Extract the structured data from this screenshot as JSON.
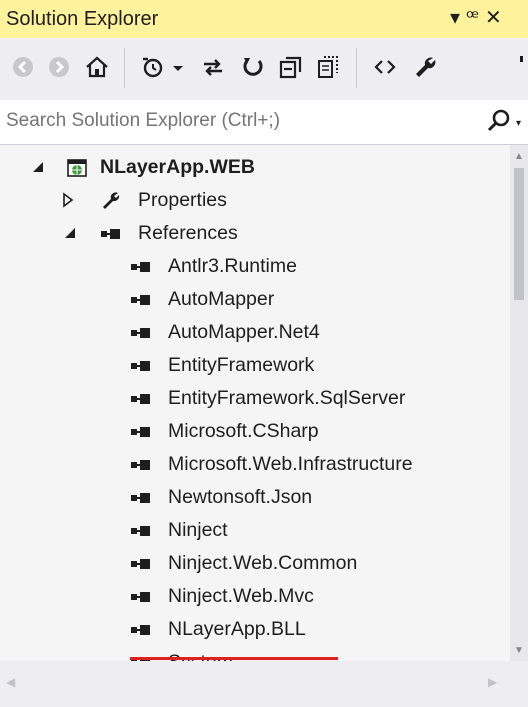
{
  "window": {
    "title": "Solution Explorer",
    "controls": "▾ ⊥ ✕"
  },
  "toolbar": {
    "items": [
      "back-icon",
      "forward-icon",
      "home-icon",
      "history-icon",
      "sync-icon",
      "refresh-icon",
      "collapse-all-icon",
      "show-all-files-icon",
      "view-code-icon",
      "properties-icon"
    ]
  },
  "search": {
    "placeholder": "Search Solution Explorer (Ctrl+;)"
  },
  "tree": {
    "project": "NLayerApp.WEB",
    "properties": "Properties",
    "references": "References",
    "refs": [
      "Antlr3.Runtime",
      "AutoMapper",
      "AutoMapper.Net4",
      "EntityFramework",
      "EntityFramework.SqlServer",
      "Microsoft.CSharp",
      "Microsoft.Web.Infrastructure",
      "Newtonsoft.Json",
      "Ninject",
      "Ninject.Web.Common",
      "Ninject.Web.Mvc",
      "NLayerApp.BLL",
      "System"
    ]
  },
  "colors": {
    "title_bg": "#fff29d",
    "highlight": "#e02020",
    "toolbar_bg": "#eeeef2"
  }
}
